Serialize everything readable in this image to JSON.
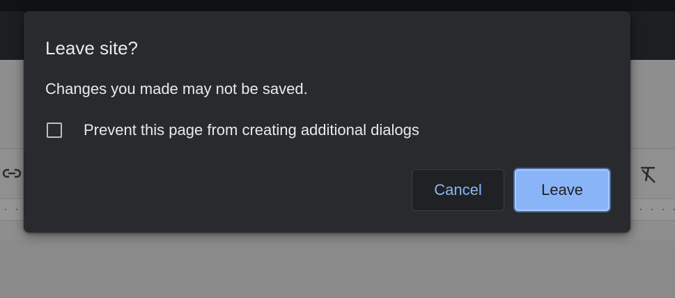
{
  "dialog": {
    "title": "Leave site?",
    "message": "Changes you made may not be saved.",
    "checkbox": {
      "label": "Prevent this page from creating additional dialogs",
      "checked": false
    },
    "buttons": {
      "cancel_label": "Cancel",
      "leave_label": "Leave"
    }
  },
  "background": {
    "toolbar_icons": [
      "link-icon",
      "clear-formatting-icon"
    ]
  },
  "colors": {
    "dialog_bg": "#292a2d",
    "text": "#e8eaed",
    "accent": "#8ab4f8",
    "dimmed_page": "#8e8e8e"
  }
}
